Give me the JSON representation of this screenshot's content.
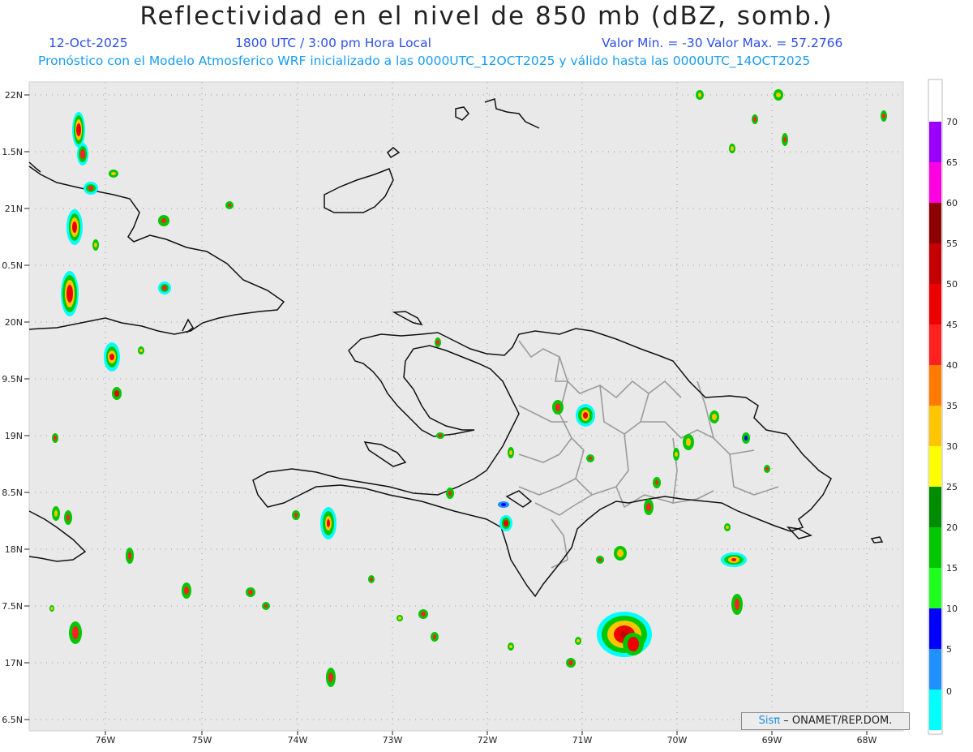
{
  "header": {
    "title": "Reflectividad en el nivel de 850 mb (dBZ, somb.)",
    "date": "12-Oct-2025",
    "time": "1800 UTC / 3:00 pm Hora Local",
    "min_max": "Valor Min. = -30  Valor Max. = 57.2766",
    "description": "Pronóstico con el Modelo Atmosferico WRF inicializado a las 0000UTC_12OCT2025 y válido hasta las  0000UTC_14OCT2025"
  },
  "map": {
    "lon_labels": [
      "76W",
      "75W",
      "74W",
      "73W",
      "72W",
      "71W",
      "70W",
      "69W",
      "68W"
    ],
    "lat_labels": [
      "22N",
      "1.5N",
      "21N",
      "0.5N",
      "20N",
      "9.5N",
      "19N",
      "8.5N",
      "18N",
      "7.5N",
      "17N",
      "6.5N"
    ],
    "background_color": "#e9e9e9"
  },
  "colorbar": {
    "labels": [
      "70",
      "65",
      "60",
      "55",
      "50",
      "45",
      "40",
      "35",
      "30",
      "25",
      "20",
      "15",
      "10",
      "5",
      "0"
    ],
    "colors": [
      "#9a00ff",
      "#ff00e0",
      "#8e0000",
      "#c40000",
      "#ee0000",
      "#ff2020",
      "#ff7b00",
      "#ffc500",
      "#ffff00",
      "#008c00",
      "#00c800",
      "#1eff1e",
      "#0000ff",
      "#1e90ff",
      "#00ffff",
      "#e8e8e8"
    ]
  },
  "credit": {
    "logo": "Sisπ",
    "text": "– ONAMET/REP.DOM."
  }
}
